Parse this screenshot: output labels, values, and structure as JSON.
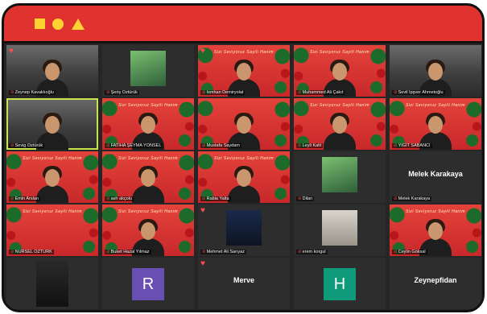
{
  "window": {
    "controls": [
      "yellow-square",
      "yellow-circle",
      "yellow-triangle"
    ],
    "accent": "#e0332f",
    "control_color": "#ffd233"
  },
  "grid": {
    "banner": "Sizi Seviyoruz Sayili Hanim",
    "row1": {
      "t1": "Zeynep Kavaklıoğlu",
      "t2": "Şeriş Öztürük",
      "t3": "İsmhan Demiryolat",
      "t4": "Muhammed Ali Çakıt",
      "t5": "Sevil İpşver Ahmetoğlu"
    },
    "row2": {
      "t1": "Sevig Öztürük",
      "t2": "FATIHA ŞEYMA YÖNSEL",
      "t3": "Mustafa Saydam",
      "t4": "Leyli Kafıl",
      "t5": "YİĞİT SABANCI"
    },
    "row3": {
      "t1": "Emin Arslan",
      "t2": "ash akçolu",
      "t3": "Rabia Yalta",
      "t4": "Dilan",
      "t5": "Melek Karakaya",
      "t5_big": "Melek Karakaya"
    },
    "row4": {
      "t1": "NURSEL OZTURK",
      "t2": "Buket Hazal Yılmaz",
      "t3": "Mehmet Ali Sarıyaz",
      "t4": "erem korgul",
      "t5": "Ceylin Göksal"
    },
    "row5": {
      "t2_avatar": "R",
      "t2_color": "#6a4fb3",
      "t3_big": "Merve",
      "t4_avatar": "H",
      "t4_color": "#0f9b7a",
      "t5_big": "Zeynepfidan"
    }
  }
}
